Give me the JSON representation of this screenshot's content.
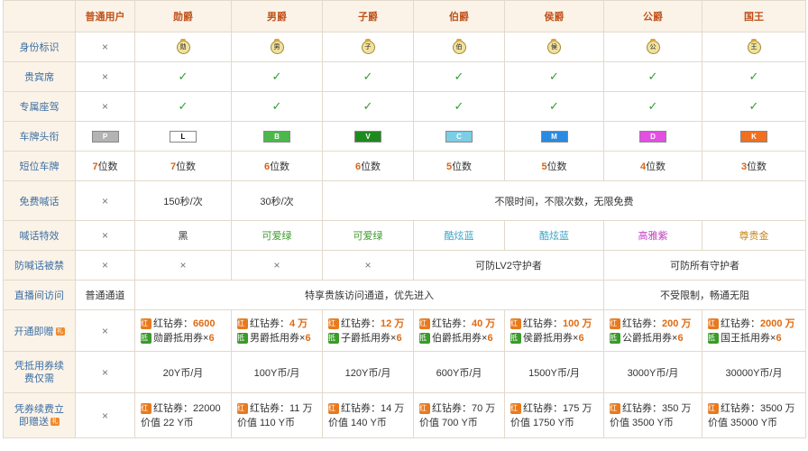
{
  "columns": [
    "普通用户",
    "勋爵",
    "男爵",
    "子爵",
    "伯爵",
    "侯爵",
    "公爵",
    "国王"
  ],
  "rows": {
    "identity": "身份标识",
    "vip_seat": "贵宾席",
    "exclusive_car": "专属座驾",
    "plate_header": "车牌头衔",
    "short_plate": "短位车牌",
    "free_shout": "免费喊话",
    "shout_effect": "喊话特效",
    "anti_ban": "防喊话被禁",
    "live_access": "直播间访问",
    "open_gift": "开通即赠",
    "renew_fee": "凭抵用券续费仅需",
    "renew_gift": "凭券续费立即赠送"
  },
  "x": "×",
  "check": "✓",
  "badges": [
    "勋",
    "男",
    "子",
    "伯",
    "侯",
    "公",
    "王"
  ],
  "plates": [
    {
      "letter": "P",
      "bg": "#b3b3b3",
      "fg": "#fff"
    },
    {
      "letter": "L",
      "bg": "#ffffff",
      "fg": "#000"
    },
    {
      "letter": "B",
      "bg": "#4bb84b",
      "fg": "#fff"
    },
    {
      "letter": "V",
      "bg": "#1e8a1e",
      "fg": "#fff"
    },
    {
      "letter": "C",
      "bg": "#7ccde6",
      "fg": "#fff"
    },
    {
      "letter": "M",
      "bg": "#2a8ae0",
      "fg": "#fff"
    },
    {
      "letter": "D",
      "bg": "#e24fe2",
      "fg": "#fff"
    },
    {
      "letter": "K",
      "bg": "#f07020",
      "fg": "#fff"
    }
  ],
  "short_plate_nums": [
    "7",
    "7",
    "6",
    "6",
    "5",
    "5",
    "4",
    "3"
  ],
  "short_plate_unit": "位数",
  "free_shout": {
    "xunjue": "150秒/次",
    "nanjue": "30秒/次",
    "unlimited": "不限时间，不限次数，无限免费"
  },
  "shout_effect": {
    "xunjue": "黑",
    "nanjue": "可爱绿",
    "zijue": "可爱绿",
    "bojue": "酷炫蓝",
    "houjue": "酷炫蓝",
    "gongjue": "高雅紫",
    "guowang": "尊贵金"
  },
  "anti_ban": {
    "lv2": "可防LV2守护者",
    "all": "可防所有守护者"
  },
  "live_access": {
    "normal": "普通通道",
    "vip": "特享贵族访问通道，优先进入",
    "unlimited": "不受限制，畅通无阻"
  },
  "tags": {
    "red": "红",
    "green": "抵"
  },
  "gift_icon": "礼",
  "open_gift": [
    {
      "line1": "红钻券：",
      "amount": "6600",
      "line2": "勋爵抵用券×",
      "count": "6"
    },
    {
      "line1": "红钻券：",
      "amount": "4 万",
      "line2": "男爵抵用券×",
      "count": "6"
    },
    {
      "line1": "红钻券：",
      "amount": "12 万",
      "line2": "子爵抵用券×",
      "count": "6"
    },
    {
      "line1": "红钻券：",
      "amount": "40 万",
      "line2": "伯爵抵用券×",
      "count": "6"
    },
    {
      "line1": "红钻券：",
      "amount": "100 万",
      "line2": "侯爵抵用券×",
      "count": "6"
    },
    {
      "line1": "红钻券：",
      "amount": "200 万",
      "line2": "公爵抵用券×",
      "count": "6"
    },
    {
      "line1": "红钻券：",
      "amount": "2000 万",
      "line2": "国王抵用券×",
      "count": "6"
    }
  ],
  "renew_fee": [
    "20Y币/月",
    "100Y币/月",
    "120Y币/月",
    "600Y币/月",
    "1500Y币/月",
    "3000Y币/月",
    "30000Y币/月"
  ],
  "renew_gift": [
    {
      "line1": "红钻券：22000",
      "line2": "价值 22 Y币"
    },
    {
      "line1": "红钻券：11 万",
      "line2": "价值 110 Y币"
    },
    {
      "line1": "红钻券：14 万",
      "line2": "价值 140 Y币"
    },
    {
      "line1": "红钻券：70 万",
      "line2": "价值 700 Y币"
    },
    {
      "line1": "红钻券：175 万",
      "line2": "价值 1750 Y币"
    },
    {
      "line1": "红钻券：350 万",
      "line2": "价值 3500 Y币"
    },
    {
      "line1": "红钻券：3500 万",
      "line2": "价值 35000 Y币"
    }
  ]
}
